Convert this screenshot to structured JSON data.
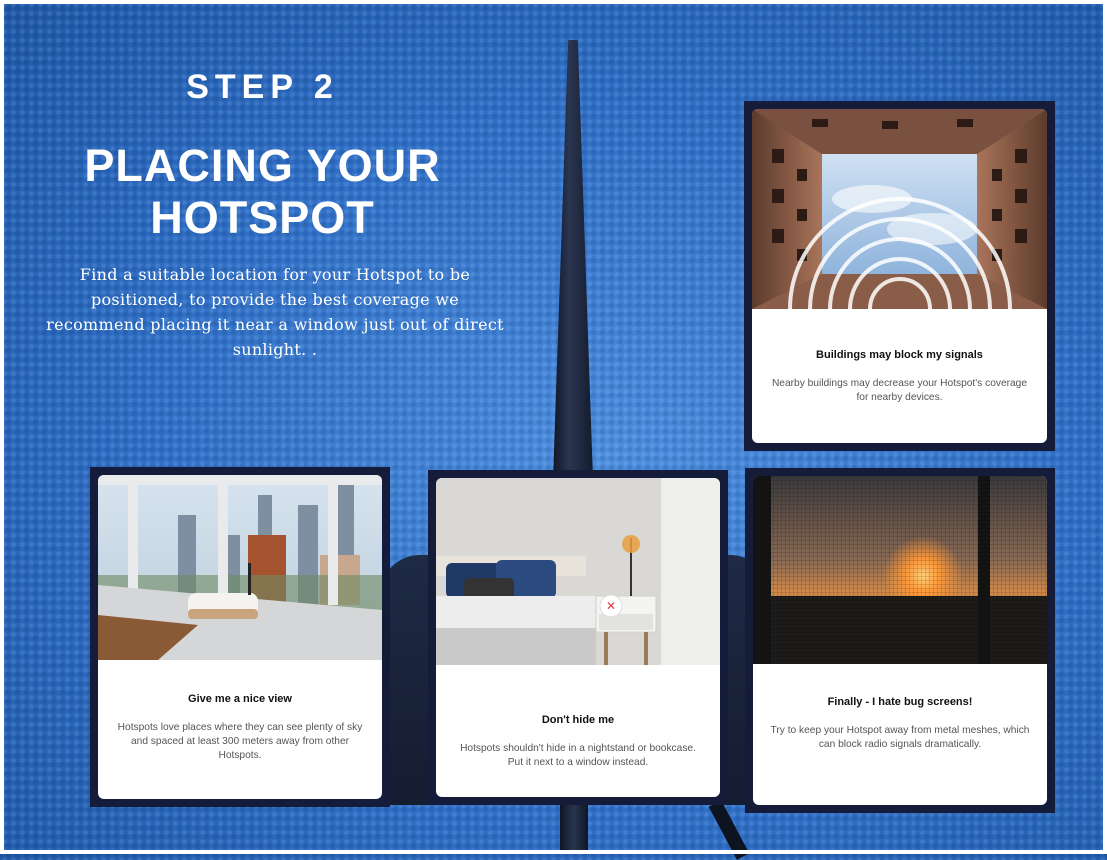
{
  "header": {
    "step": "STEP 2",
    "title_line1": "PLACING YOUR",
    "title_line2": "HOTSPOT",
    "intro": "Find a suitable location for your Hotspot to be positioned, to provide the best coverage we recommend placing it near a window just out of direct sunlight. ."
  },
  "cards": [
    {
      "title": "Buildings may block my signals",
      "text": "Nearby buildings may decrease your Hotspot's coverage for nearby devices.",
      "image": "courtyard-looking-up-with-signal-arcs"
    },
    {
      "title": "Give me a nice view",
      "text": "Hotspots love places where they can see plenty of sky and spaced at least 300 meters away from other Hotspots.",
      "image": "hotspot-on-window-sill-city-view"
    },
    {
      "title": "Don't hide me",
      "text": "Hotspots shouldn't hide in a nightstand or bookcase. Put it next to a window instead.",
      "image": "bedroom-nightstand-with-x-marker"
    },
    {
      "title": "Finally - I hate bug screens!",
      "text": "Try to keep your Hotspot away from metal meshes, which can block radio signals dramatically.",
      "image": "sunset-through-mesh-screen"
    }
  ],
  "colors": {
    "background": "#2f6fc6",
    "card_border": "#151c3a",
    "heading_text": "#ffffff"
  }
}
